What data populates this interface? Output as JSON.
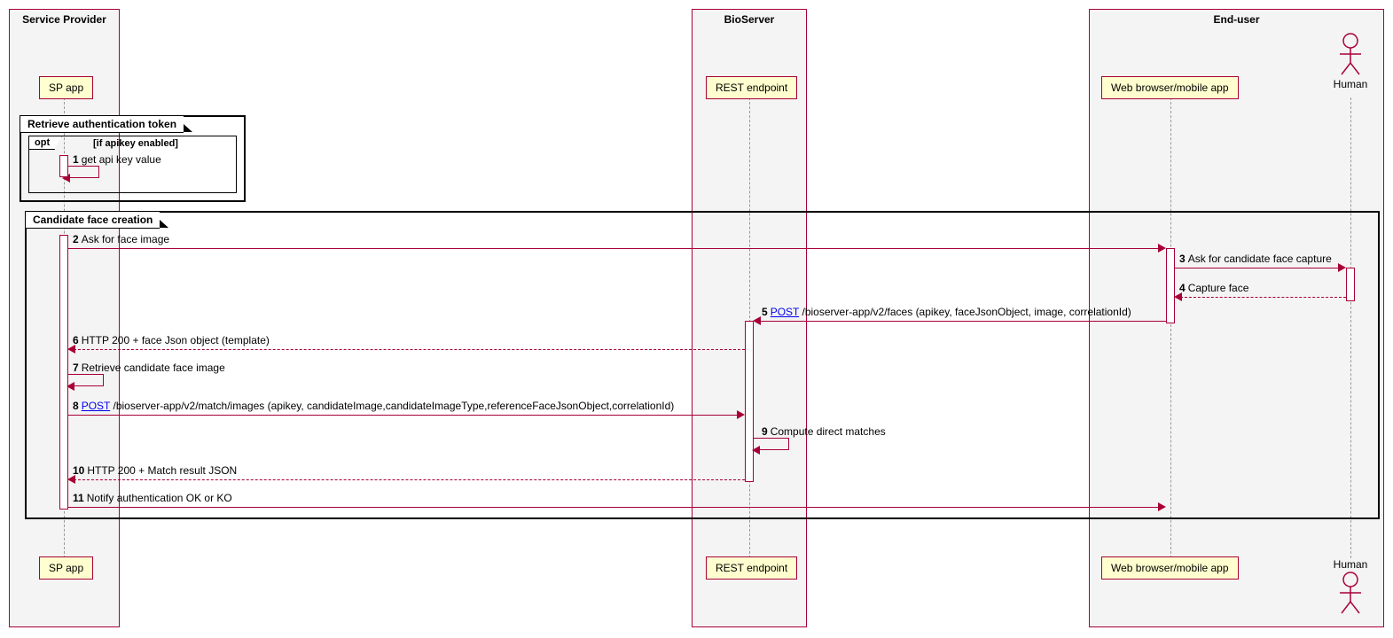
{
  "participants": {
    "sp": {
      "title": "Service Provider",
      "box": "SP app"
    },
    "bio": {
      "title": "BioServer",
      "box": "REST endpoint"
    },
    "eu": {
      "title": "End-user",
      "box": "Web browser/mobile app",
      "actor": "Human"
    }
  },
  "groups": {
    "g1": {
      "title": "Retrieve authentication token"
    },
    "opt": {
      "label": "opt",
      "guard": "[if apikey enabled]"
    },
    "g2": {
      "title": "Candidate face creation"
    }
  },
  "messages": {
    "m1": {
      "num": "1",
      "text": "get api key value"
    },
    "m2": {
      "num": "2",
      "text": "Ask for face image"
    },
    "m3": {
      "num": "3",
      "text": "Ask for candidate face capture"
    },
    "m4": {
      "num": "4",
      "text": "Capture face"
    },
    "m5": {
      "num": "5",
      "verb": "POST",
      "text": "/bioserver-app/v2/faces (apikey, faceJsonObject, image, correlationId)"
    },
    "m6": {
      "num": "6",
      "text": "HTTP 200 + face Json object (template)"
    },
    "m7": {
      "num": "7",
      "text": "Retrieve candidate face image"
    },
    "m8": {
      "num": "8",
      "verb": "POST",
      "text": "/bioserver-app/v2/match/images (apikey,  candidateImage,candidateImageType,referenceFaceJsonObject,correlationId)"
    },
    "m9": {
      "num": "9",
      "text": "Compute direct matches"
    },
    "m10": {
      "num": "10",
      "text": "HTTP 200 + Match result JSON"
    },
    "m11": {
      "num": "11",
      "text": "Notify authentication OK or KO"
    }
  }
}
